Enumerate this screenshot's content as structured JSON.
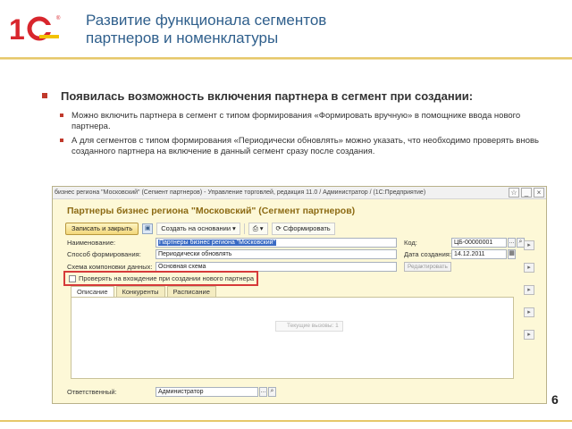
{
  "slide": {
    "title_line1": "Развитие функционала сегментов",
    "title_line2": "партнеров и номенклатуры",
    "main_bullet": "Появилась возможность включения партнера в сегмент при создании:",
    "sub_bullets": [
      "Можно включить партнера в сегмент с типом формирования «Формировать вручную» в помощнике ввода нового партнера.",
      "А для сегментов с типом формирования «Периодически обновлять» можно указать, что необходимо проверять вновь созданного партнера на включение в данный сегмент сразу после создания."
    ],
    "page_number": "6",
    "accent_color": "#c0392b",
    "title_color": "#2f5f8c"
  },
  "logo": {
    "text": "1С",
    "mark": "®",
    "icon": "1c-logo-icon"
  },
  "window": {
    "title": "бизнес региона \"Московский\" (Сегмент партнеров) - Управление торговлей, редакция 11.0 / Администратор / (1С:Предприятие)",
    "form_title": "Партнеры бизнес региона \"Московский\" (Сегмент партнеров)",
    "toolbar": {
      "save_close": "Записать и закрыть",
      "create_based": "Создать на основании",
      "generate": "Сформировать"
    },
    "fields": {
      "name_label": "Наименование:",
      "name_value": "Партнеры бизнес региона \"Московский\"",
      "code_label": "Код:",
      "code_value": "ЦБ-00000001",
      "method_label": "Способ формирования:",
      "method_value": "Периодически обновлять",
      "date_label": "Дата создания:",
      "date_value": "14.12.2011",
      "scheme_label": "Схема компоновки данных:",
      "scheme_value": "Основная схема",
      "edit_button": "Редактировать",
      "responsible_label": "Ответственный:",
      "responsible_value": "Администратор"
    },
    "checkbox_label": "Проверять на вхождение при создании нового партнера",
    "tabs": [
      "Описание",
      "Конкуренты",
      "Расписание"
    ],
    "tooltip": "Текущие вызовы: 1"
  }
}
